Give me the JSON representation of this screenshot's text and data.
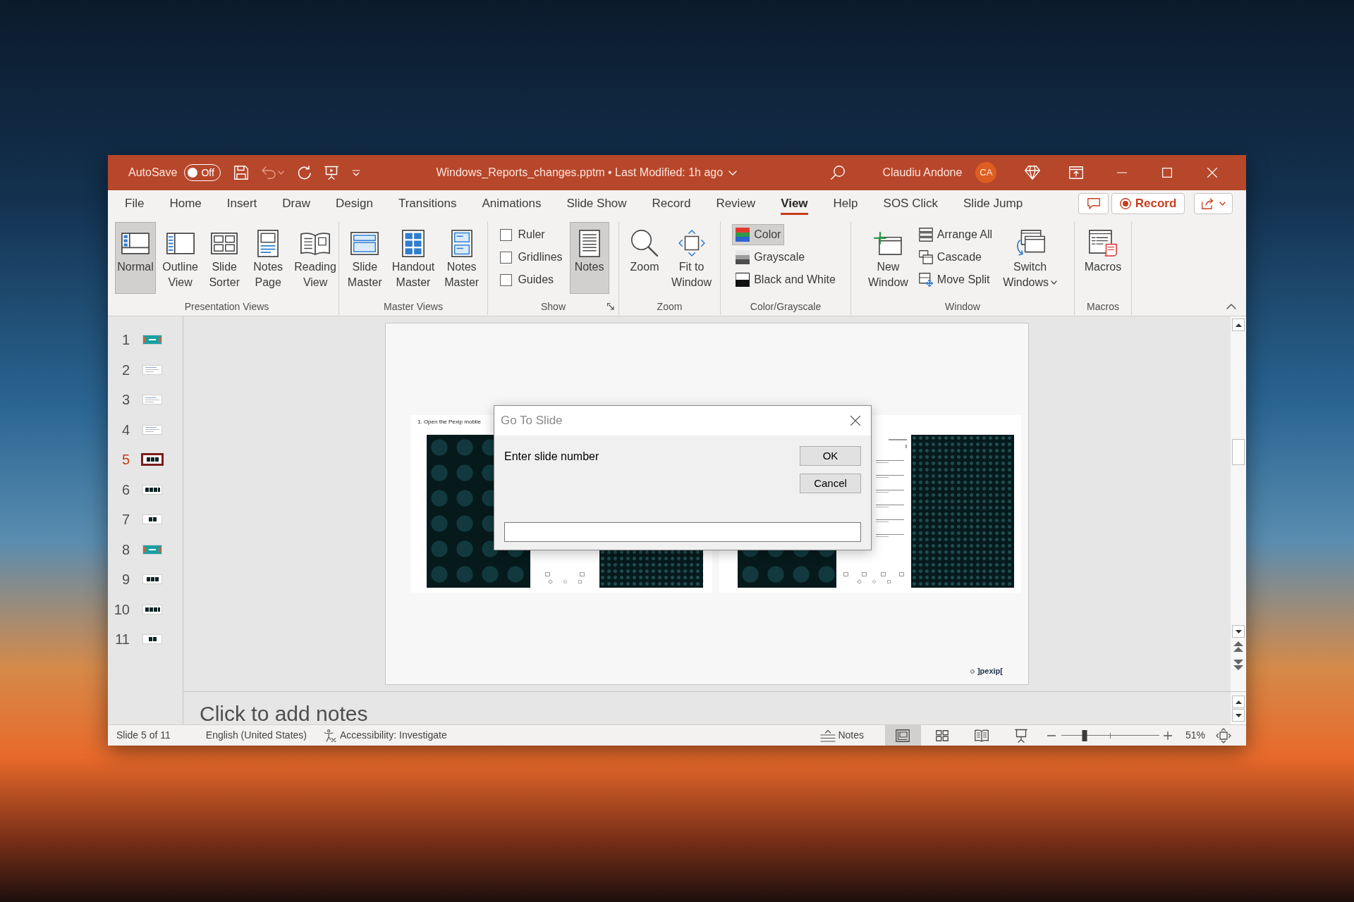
{
  "window": {
    "title": "Windows_Reports_changes.pptm • Last Modified: 1h ago"
  },
  "quick_access": {
    "autosave_label": "AutoSave",
    "autosave": {
      "label": "Off",
      "on": false
    },
    "undo_disabled": true
  },
  "account": {
    "name": "Claudiu Andone",
    "initials": "CA"
  },
  "tabs": [
    {
      "label": "File",
      "selected": false
    },
    {
      "label": "Home",
      "selected": false
    },
    {
      "label": "Insert",
      "selected": false
    },
    {
      "label": "Draw",
      "selected": false
    },
    {
      "label": "Design",
      "selected": false
    },
    {
      "label": "Transitions",
      "selected": false
    },
    {
      "label": "Animations",
      "selected": false
    },
    {
      "label": "Slide Show",
      "selected": false
    },
    {
      "label": "Record",
      "selected": false
    },
    {
      "label": "Review",
      "selected": false
    },
    {
      "label": "View",
      "selected": true
    },
    {
      "label": "Help",
      "selected": false
    },
    {
      "label": "SOS Click",
      "selected": false
    },
    {
      "label": "Slide Jump",
      "selected": false
    }
  ],
  "tab_actions": {
    "record_button": "Record"
  },
  "ribbon": {
    "groups": [
      {
        "label": "Presentation Views",
        "launcher": false,
        "items": [
          {
            "kind": "large",
            "lines": [
              "Normal"
            ],
            "selected": true,
            "dropdown": false
          },
          {
            "kind": "large",
            "lines": [
              "Outline",
              "View"
            ],
            "selected": false,
            "dropdown": false
          },
          {
            "kind": "large",
            "lines": [
              "Slide",
              "Sorter"
            ],
            "selected": false,
            "dropdown": false
          },
          {
            "kind": "large",
            "lines": [
              "Notes",
              "Page"
            ],
            "selected": false,
            "dropdown": false
          },
          {
            "kind": "large",
            "lines": [
              "Reading",
              "View"
            ],
            "selected": false,
            "dropdown": false
          }
        ]
      },
      {
        "label": "Master Views",
        "launcher": false,
        "items": [
          {
            "kind": "large",
            "lines": [
              "Slide",
              "Master"
            ],
            "selected": false,
            "dropdown": false
          },
          {
            "kind": "large",
            "lines": [
              "Handout",
              "Master"
            ],
            "selected": false,
            "dropdown": false
          },
          {
            "kind": "large",
            "lines": [
              "Notes",
              "Master"
            ],
            "selected": false,
            "dropdown": false
          }
        ]
      },
      {
        "label": "Show",
        "launcher": true,
        "items": [
          {
            "kind": "checkbox",
            "label": "Ruler",
            "checked": false
          },
          {
            "kind": "checkbox",
            "label": "Gridlines",
            "checked": false
          },
          {
            "kind": "checkbox",
            "label": "Guides",
            "checked": false
          },
          {
            "kind": "large",
            "lines": [
              "Notes"
            ],
            "selected": true,
            "dropdown": false
          }
        ]
      },
      {
        "label": "Zoom",
        "launcher": false,
        "items": [
          {
            "kind": "large",
            "lines": [
              "Zoom"
            ],
            "selected": false,
            "dropdown": false
          },
          {
            "kind": "large",
            "lines": [
              "Fit to",
              "Window"
            ],
            "selected": false,
            "dropdown": false
          }
        ]
      },
      {
        "label": "Color/Grayscale",
        "launcher": false,
        "items": [
          {
            "kind": "small",
            "label": "Color",
            "selected": true
          },
          {
            "kind": "small",
            "label": "Grayscale",
            "selected": false
          },
          {
            "kind": "small",
            "label": "Black and White",
            "selected": false
          }
        ]
      },
      {
        "label": "Window",
        "launcher": false,
        "items": [
          {
            "kind": "large",
            "lines": [
              "New",
              "Window"
            ],
            "selected": false,
            "dropdown": false
          },
          {
            "kind": "small",
            "label": "Arrange All",
            "selected": false
          },
          {
            "kind": "small",
            "label": "Cascade",
            "selected": false
          },
          {
            "kind": "small",
            "label": "Move Split",
            "selected": false
          },
          {
            "kind": "large",
            "lines": [
              "Switch",
              "Windows"
            ],
            "selected": false,
            "dropdown": true
          }
        ]
      },
      {
        "label": "Macros",
        "launcher": false,
        "items": [
          {
            "kind": "large",
            "lines": [
              "Macros"
            ],
            "selected": false,
            "dropdown": false
          }
        ]
      }
    ]
  },
  "thumbnails": [
    {
      "number": "1",
      "kind": "cover",
      "selected": false
    },
    {
      "number": "2",
      "kind": "text",
      "selected": false
    },
    {
      "number": "3",
      "kind": "text",
      "selected": false
    },
    {
      "number": "4",
      "kind": "text",
      "selected": false
    },
    {
      "number": "5",
      "kind": "triple",
      "selected": true
    },
    {
      "number": "6",
      "kind": "quad",
      "selected": false
    },
    {
      "number": "7",
      "kind": "pair",
      "selected": false
    },
    {
      "number": "8",
      "kind": "cover",
      "selected": false
    },
    {
      "number": "9",
      "kind": "triple",
      "selected": false
    },
    {
      "number": "10",
      "kind": "quad",
      "selected": false
    },
    {
      "number": "11",
      "kind": "pair",
      "selected": false
    }
  ],
  "slide": {
    "caption": "1. Open the Pexip mobile",
    "logo": "]pexip["
  },
  "notes": {
    "placeholder": "Click to add notes"
  },
  "dialog": {
    "title": "Go To Slide",
    "prompt": "Enter slide number",
    "buttons": [
      "OK",
      "Cancel"
    ]
  },
  "status_bar": {
    "slide_info": "Slide 5 of 11",
    "language": "English (United States)",
    "accessibility": "Accessibility: Investigate",
    "notes_button": "Notes",
    "views": [
      {
        "selected": true
      },
      {
        "selected": false
      },
      {
        "selected": false
      },
      {
        "selected": false
      }
    ],
    "zoom": {
      "level": 0.24,
      "reading": "51%"
    }
  }
}
